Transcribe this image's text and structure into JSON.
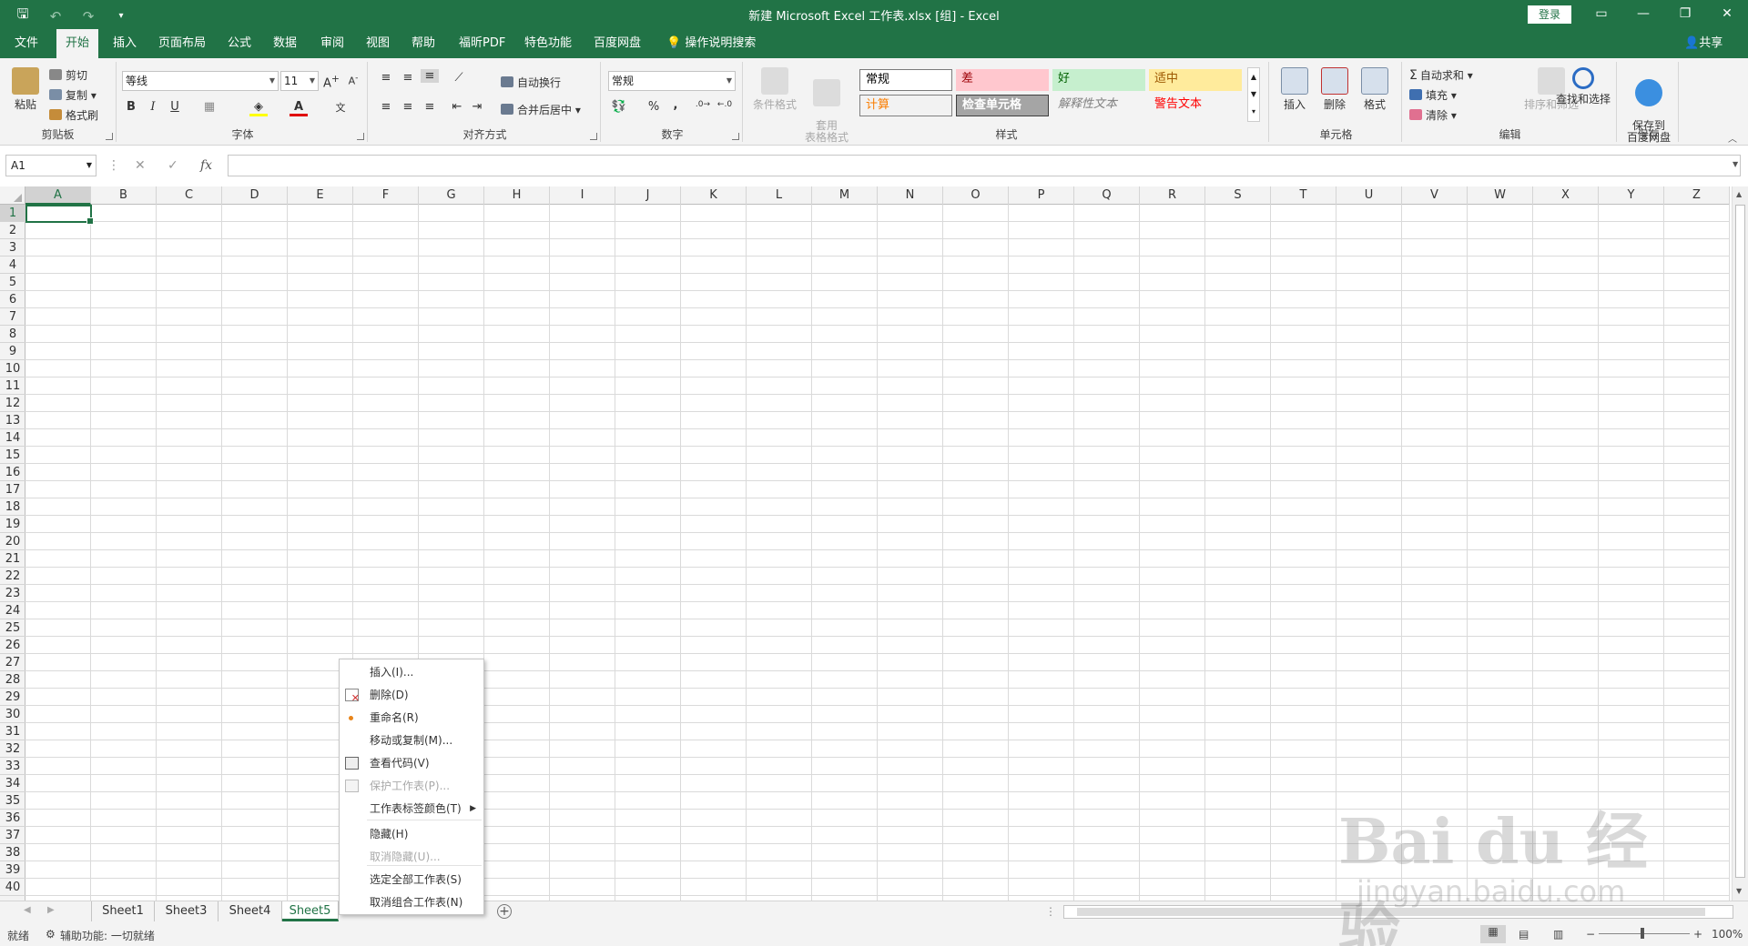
{
  "window": {
    "title": "新建 Microsoft Excel 工作表.xlsx  [组]  -  Excel",
    "login_label": "登录",
    "qat": {
      "save_icon": "save-icon",
      "undo_icon": "undo-icon",
      "redo_icon": "redo-icon",
      "customize_icon": "customize-qat-icon"
    }
  },
  "ribbon_tabs": [
    "文件",
    "开始",
    "插入",
    "页面布局",
    "公式",
    "数据",
    "审阅",
    "视图",
    "帮助",
    "福昕PDF",
    "特色功能",
    "百度网盘",
    "操作说明搜索"
  ],
  "active_tab": "开始",
  "share_label": "共享",
  "ribbon": {
    "clipboard": {
      "label": "剪贴板",
      "paste": "粘贴",
      "cut": "剪切",
      "copy": "复制",
      "format_painter": "格式刷"
    },
    "font": {
      "label": "字体",
      "font_name": "等线",
      "font_size": "11"
    },
    "alignment": {
      "label": "对齐方式",
      "wrap_text": "自动换行",
      "merge_center": "合并后居中"
    },
    "number": {
      "label": "数字",
      "format": "常规",
      "percent": "%",
      "comma": ","
    },
    "styles": {
      "label": "样式",
      "conditional": "条件格式",
      "table_format": "套用\n表格格式",
      "cells": [
        {
          "text": "常规",
          "bg": "#ffffff",
          "fg": "#000000",
          "border": "#7a7a7a"
        },
        {
          "text": "差",
          "bg": "#ffc7ce",
          "fg": "#9c0006"
        },
        {
          "text": "好",
          "bg": "#c6efce",
          "fg": "#006100"
        },
        {
          "text": "适中",
          "bg": "#ffeb9c",
          "fg": "#9c5700"
        },
        {
          "text": "计算",
          "bg": "#f2f2f2",
          "fg": "#fa7d00",
          "border": "#7f7f7f"
        },
        {
          "text": "检查单元格",
          "bg": "#a5a5a5",
          "fg": "#ffffff",
          "border": "#3f3f3f"
        },
        {
          "text": "解释性文本",
          "bg": "#f3f3f3",
          "fg": "#7f7f7f"
        },
        {
          "text": "警告文本",
          "bg": "#f3f3f3",
          "fg": "#ff0000"
        }
      ]
    },
    "cells": {
      "label": "单元格",
      "insert": "插入",
      "delete": "删除",
      "format": "格式"
    },
    "editing": {
      "label": "编辑",
      "autosum": "自动求和",
      "fill": "填充",
      "clear": "清除",
      "sort_filter": "排序和筛选",
      "find_select": "查找和选择"
    },
    "save": {
      "label": "保存",
      "save_to_baidu": "保存到\n百度网盘"
    }
  },
  "formula_bar": {
    "name_box": "A1",
    "cancel": "✕",
    "enter": "✓",
    "fx": "fx",
    "value": ""
  },
  "columns": [
    "A",
    "B",
    "C",
    "D",
    "E",
    "F",
    "G",
    "H",
    "I",
    "J",
    "K",
    "L",
    "M",
    "N",
    "O",
    "P",
    "Q",
    "R",
    "S",
    "T",
    "U",
    "V",
    "W",
    "X",
    "Y",
    "Z"
  ],
  "rows": [
    "1",
    "2",
    "3",
    "4",
    "5",
    "6",
    "7",
    "8",
    "9",
    "10",
    "11",
    "12",
    "13",
    "14",
    "15",
    "16",
    "17",
    "18",
    "19",
    "20",
    "21",
    "22",
    "23",
    "24",
    "25",
    "26",
    "27",
    "28",
    "29",
    "30",
    "31",
    "32",
    "33",
    "34",
    "35",
    "36",
    "37",
    "38",
    "39",
    "40"
  ],
  "selected_cell": "A1",
  "sheets": [
    "Sheet1",
    "Sheet3",
    "Sheet4",
    "Sheet5"
  ],
  "active_sheet": "Sheet5",
  "context_menu": [
    {
      "label": "插入(I)...",
      "icon": "",
      "disabled": false
    },
    {
      "label": "删除(D)",
      "icon": "delete-sheet-icon",
      "disabled": false
    },
    {
      "label": "重命名(R)",
      "icon": "rename-dot-icon",
      "disabled": false
    },
    {
      "label": "移动或复制(M)...",
      "icon": "",
      "disabled": false
    },
    {
      "label": "查看代码(V)",
      "icon": "view-code-icon",
      "disabled": false
    },
    {
      "label": "保护工作表(P)...",
      "icon": "protect-sheet-icon",
      "disabled": true
    },
    {
      "label": "工作表标签颜色(T)",
      "icon": "",
      "disabled": false,
      "submenu": true
    },
    {
      "label": "隐藏(H)",
      "icon": "",
      "disabled": false
    },
    {
      "label": "取消隐藏(U)...",
      "icon": "",
      "disabled": true
    },
    {
      "label": "选定全部工作表(S)",
      "icon": "",
      "disabled": false
    },
    {
      "label": "取消组合工作表(N)",
      "icon": "",
      "disabled": false
    }
  ],
  "status": {
    "ready": "就绪",
    "accessibility": "辅助功能: 一切就绪",
    "zoom": "100%"
  },
  "watermark": {
    "brand": "Bai du 经验",
    "url": "jingyan.baidu.com"
  }
}
